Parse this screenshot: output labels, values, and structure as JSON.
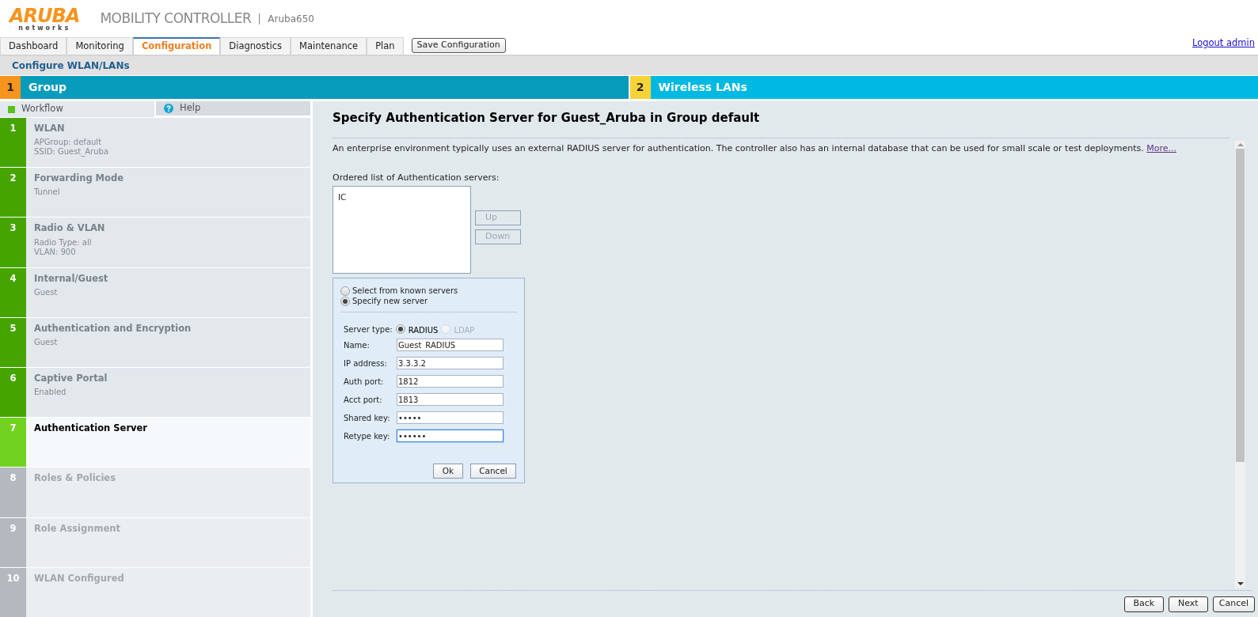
{
  "logo": {
    "brand": "ARUBA",
    "sub": "networks"
  },
  "product": {
    "title": "MOBILITY CONTROLLER",
    "device": "Aruba650"
  },
  "nav_tabs": [
    {
      "label": "Dashboard",
      "selected": false
    },
    {
      "label": "Monitoring",
      "selected": false
    },
    {
      "label": "Configuration",
      "selected": true
    },
    {
      "label": "Diagnostics",
      "selected": false
    },
    {
      "label": "Maintenance",
      "selected": false
    },
    {
      "label": "Plan",
      "selected": false
    }
  ],
  "save_button": "Save Configuration",
  "logout_link": "Logout admin",
  "breadcrumb": "Configure WLAN/LANs",
  "wizard_steps": [
    {
      "number": "1",
      "label": "Group",
      "selected": true
    },
    {
      "number": "2",
      "label": "Wireless LANs",
      "selected": false
    }
  ],
  "sidebar": {
    "tabs": [
      {
        "label": "Workflow",
        "selected": true,
        "kind": "workflow"
      },
      {
        "label": "Help",
        "selected": false,
        "kind": "help"
      }
    ],
    "steps": [
      {
        "number": "1",
        "title": "WLAN",
        "details": [
          "APGroup: default",
          "SSID: Guest_Aruba"
        ],
        "completed": true,
        "selected": false
      },
      {
        "number": "2",
        "title": "Forwarding Mode",
        "details": [
          "Tunnel"
        ],
        "completed": true,
        "selected": false
      },
      {
        "number": "3",
        "title": "Radio & VLAN",
        "details": [
          "Radio Type: all",
          "VLAN: 900"
        ],
        "completed": true,
        "selected": false
      },
      {
        "number": "4",
        "title": "Internal/Guest",
        "details": [
          "Guest"
        ],
        "completed": true,
        "selected": false
      },
      {
        "number": "5",
        "title": "Authentication and Encryption",
        "details": [
          "Guest"
        ],
        "completed": true,
        "selected": false
      },
      {
        "number": "6",
        "title": "Captive Portal",
        "details": [
          "Enabled"
        ],
        "completed": true,
        "selected": false
      },
      {
        "number": "7",
        "title": "Authentication Server",
        "completed": false,
        "selected": true
      },
      {
        "number": "8",
        "title": "Roles & Policies",
        "completed": false,
        "selected": false
      },
      {
        "number": "9",
        "title": "Role Assignment",
        "completed": false,
        "selected": false
      },
      {
        "number": "10",
        "title": "WLAN Configured",
        "completed": false,
        "selected": false
      }
    ]
  },
  "content": {
    "title": "Specify Authentication Server for Guest_Aruba in Group default",
    "description": "An enterprise environment typically uses an external RADIUS server for authentication. The controller also has an internal database that can be used for small scale or test deployments.",
    "more_link": "More...",
    "list_label": "Ordered list of Authentication servers:",
    "servers": [
      "IC"
    ],
    "order_buttons": [
      {
        "label": "Up",
        "disabled": true
      },
      {
        "label": "Down",
        "disabled": true
      }
    ],
    "source_options": [
      {
        "label": "Select from known servers",
        "selected": false
      },
      {
        "label": "Specify new server",
        "selected": true
      }
    ],
    "server_type": {
      "label": "Server type:",
      "options": [
        {
          "label": "RADIUS",
          "selected": true,
          "disabled": false
        },
        {
          "label": "LDAP",
          "selected": false,
          "disabled": true
        }
      ]
    },
    "fields": [
      {
        "label": "Name:",
        "value": "Guest_RADIUS",
        "focused": false
      },
      {
        "label": "IP address:",
        "value": "3.3.3.2",
        "focused": false
      },
      {
        "label": "Auth port:",
        "value": "1812",
        "focused": false
      },
      {
        "label": "Acct port:",
        "value": "1813",
        "focused": false
      },
      {
        "label": "Shared key:",
        "value": "•••••",
        "focused": false
      },
      {
        "label": "Retype key:",
        "value": "••••••",
        "focused": true
      }
    ],
    "form_buttons": [
      "Ok",
      "Cancel"
    ],
    "footer_buttons": [
      "Back",
      "Next",
      "Cancel"
    ]
  }
}
